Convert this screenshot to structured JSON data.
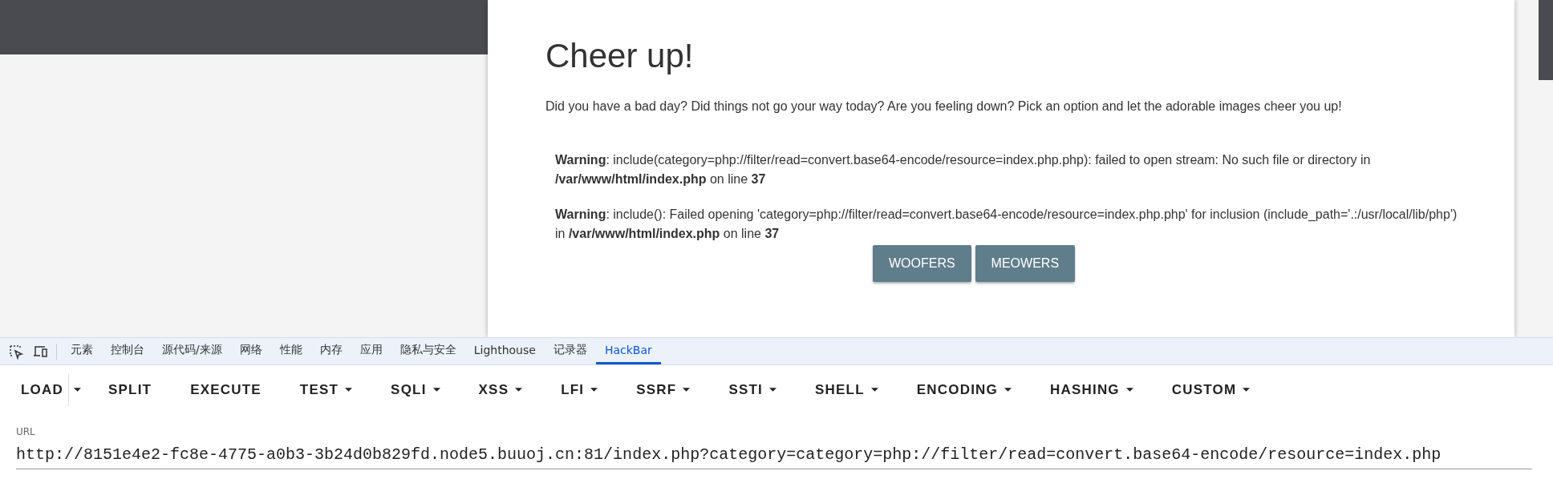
{
  "page": {
    "title": "Cheer up!",
    "intro": "Did you have a bad day? Did things not go your way today? Are you feeling down? Pick an option and let the adorable images cheer you up!",
    "warnings": [
      "**Warning**: include(category=php://filter/read=convert.base64-encode/resource=index.php.php): failed to open stream: No such file or directory in **/var/www/html/index.php** on line **37**",
      "**Warning**: include(): Failed opening 'category=php://filter/read=convert.base64-encode/resource=index.php.php' for inclusion (include_path='.:/usr/local/lib/php') in **/var/www/html/index.php** on line **37**"
    ],
    "buttons": [
      "WOOFERS",
      "MEOWERS"
    ]
  },
  "devtools": {
    "tabs": [
      {
        "label": "元素",
        "selected": false
      },
      {
        "label": "控制台",
        "selected": false
      },
      {
        "label": "源代码/来源",
        "selected": false
      },
      {
        "label": "网络",
        "selected": false
      },
      {
        "label": "性能",
        "selected": false
      },
      {
        "label": "内存",
        "selected": false
      },
      {
        "label": "应用",
        "selected": false
      },
      {
        "label": "隐私与安全",
        "selected": false
      },
      {
        "label": "Lighthouse",
        "selected": false
      },
      {
        "label": "记录器",
        "selected": false
      },
      {
        "label": "HackBar",
        "selected": true
      }
    ]
  },
  "hackbar": {
    "toolbar": [
      {
        "label": "LOAD",
        "kind": "split"
      },
      {
        "label": "SPLIT",
        "kind": "plain"
      },
      {
        "label": "EXECUTE",
        "kind": "plain"
      },
      {
        "label": "TEST",
        "kind": "menu"
      },
      {
        "label": "SQLI",
        "kind": "menu"
      },
      {
        "label": "XSS",
        "kind": "menu"
      },
      {
        "label": "LFI",
        "kind": "menu"
      },
      {
        "label": "SSRF",
        "kind": "menu"
      },
      {
        "label": "SSTI",
        "kind": "menu"
      },
      {
        "label": "SHELL",
        "kind": "menu"
      },
      {
        "label": "ENCODING",
        "kind": "menu"
      },
      {
        "label": "HASHING",
        "kind": "menu"
      },
      {
        "label": "CUSTOM",
        "kind": "menu"
      }
    ],
    "url": {
      "label": "URL",
      "value": "http://8151e4e2-fc8e-4775-a0b3-3b24d0b829fd.node5.buuoj.cn:81/index.php?category=category=php://filter/read=convert.base64-encode/resource=index.php"
    }
  }
}
